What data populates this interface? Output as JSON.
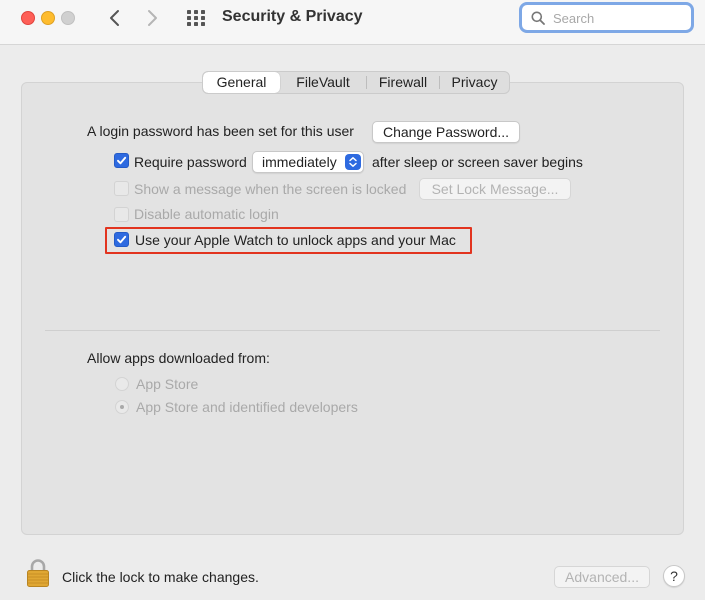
{
  "window": {
    "title": "Security & Privacy",
    "search": {
      "placeholder": "Search",
      "value": ""
    }
  },
  "tabs": [
    {
      "label": "General",
      "selected": true
    },
    {
      "label": "FileVault",
      "selected": false
    },
    {
      "label": "Firewall",
      "selected": false
    },
    {
      "label": "Privacy",
      "selected": false
    }
  ],
  "general": {
    "login_password_text": "A login password has been set for this user",
    "change_password_button": "Change Password...",
    "require_password": {
      "label": "Require password",
      "checked": true,
      "select_value": "immediately",
      "suffix": "after sleep or screen saver begins"
    },
    "show_message": {
      "label": "Show a message when the screen is locked",
      "checked": false,
      "enabled": false,
      "button": "Set Lock Message..."
    },
    "disable_auto_login": {
      "label": "Disable automatic login",
      "checked": false,
      "enabled": false
    },
    "apple_watch": {
      "label": "Use your Apple Watch to unlock apps and your Mac",
      "checked": true
    },
    "allow_apps": {
      "heading": "Allow apps downloaded from:",
      "options": [
        {
          "label": "App Store",
          "selected": false
        },
        {
          "label": "App Store and identified developers",
          "selected": true
        }
      ]
    }
  },
  "footer": {
    "lock_text": "Click the lock to make changes.",
    "advanced_button": "Advanced...",
    "help_label": "?"
  },
  "colors": {
    "accent": "#2e6ae0",
    "highlight_border": "#e2341f",
    "search_focus": "#7ea8e6"
  }
}
